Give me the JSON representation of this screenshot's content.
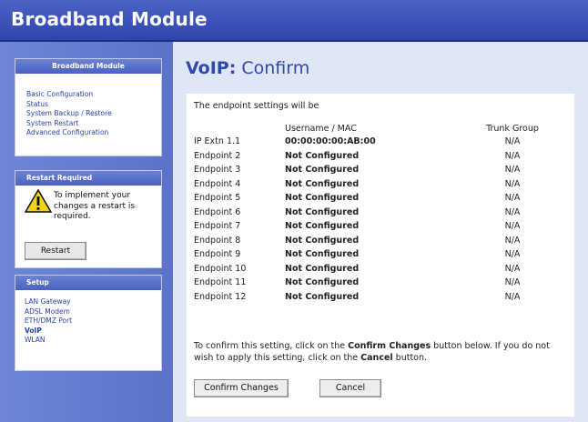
{
  "header": {
    "title": "Broadband Module"
  },
  "sidebar": {
    "main_panel": {
      "title": "Broadband Module",
      "links": [
        "Basic Configuration",
        "Status",
        "System Backup / Restore",
        "System Restart",
        "Advanced Configuration"
      ]
    },
    "restart_panel": {
      "title": "Restart Required",
      "message": "To implement your changes a restart is required.",
      "button_label": "Restart"
    },
    "setup_panel": {
      "title": "Setup",
      "links": [
        "LAN Gateway",
        "ADSL Modem",
        "ETH/DMZ Port",
        "VoIP",
        "WLAN"
      ]
    }
  },
  "main": {
    "title_prefix": "VoIP:",
    "title_suffix": " Confirm",
    "intro": "The endpoint settings will be",
    "table": {
      "headers": [
        "",
        "Username / MAC",
        "Trunk Group"
      ],
      "rows": [
        [
          "IP Extn 1.1",
          "00:00:00:00:AB:00",
          "N/A"
        ],
        [
          "Endpoint 2",
          "Not Configured",
          "N/A"
        ],
        [
          "Endpoint 3",
          "Not Configured",
          "N/A"
        ],
        [
          "Endpoint 4",
          "Not Configured",
          "N/A"
        ],
        [
          "Endpoint 5",
          "Not Configured",
          "N/A"
        ],
        [
          "Endpoint 6",
          "Not Configured",
          "N/A"
        ],
        [
          "Endpoint 7",
          "Not Configured",
          "N/A"
        ],
        [
          "Endpoint 8",
          "Not Configured",
          "N/A"
        ],
        [
          "Endpoint 9",
          "Not Configured",
          "N/A"
        ],
        [
          "Endpoint 10",
          "Not Configured",
          "N/A"
        ],
        [
          "Endpoint 11",
          "Not Configured",
          "N/A"
        ],
        [
          "Endpoint 12",
          "Not Configured",
          "N/A"
        ]
      ]
    },
    "confirm_text": {
      "part1": "To confirm this setting, click on the ",
      "bold1": "Confirm Changes",
      "part2": " button below. If you do not wish to apply this setting, click on the ",
      "bold2": "Cancel",
      "part3": " button."
    },
    "buttons": {
      "confirm": "Confirm Changes",
      "cancel": "Cancel"
    }
  },
  "colors": {
    "header_bg": "#2f45ad",
    "sidebar_bg": "#5a73c9",
    "accent": "#2f47b0",
    "main_bg": "#dfe6f6"
  },
  "icons": {
    "warning": "warning-icon"
  }
}
